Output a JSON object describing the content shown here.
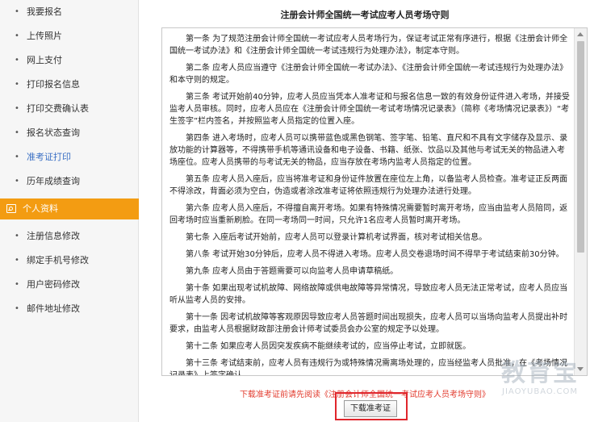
{
  "sidebar": {
    "items_top": [
      {
        "label": "我要报名",
        "active": false
      },
      {
        "label": "上传照片",
        "active": false
      },
      {
        "label": "网上支付",
        "active": false
      },
      {
        "label": "打印报名信息",
        "active": false
      },
      {
        "label": "打印交费确认表",
        "active": false
      },
      {
        "label": "报名状态查询",
        "active": false
      },
      {
        "label": "准考证打印",
        "active": true
      },
      {
        "label": "历年成绩查询",
        "active": false
      }
    ],
    "section_label": "个人资料",
    "items_bottom": [
      {
        "label": "注册信息修改"
      },
      {
        "label": "绑定手机号修改"
      },
      {
        "label": "用户密码修改"
      },
      {
        "label": "邮件地址修改"
      }
    ],
    "bullet": "•"
  },
  "main": {
    "title": "注册会计师全国统一考试应考人员考场守则",
    "rules": [
      "第一条 为了规范注册会计师全国统一考试应考人员考场行为，保证考试正常有序进行，根据《注册会计师全国统一考试办法》和《注册会计师全国统一考试违规行为处理办法》，制定本守则。",
      "第二条 应考人员应当遵守《注册会计师全国统一考试办法》、《注册会计师全国统一考试违规行为处理办法》和本守则的规定。",
      "第三条 考试开始前40分钟，应考人员应当凭本人准考证和与报名信息一致的有效身份证件进入考场，并接受监考人员审核。同时，应考人员应在《注册会计师全国统一考试考场情况记录表》（简称《考场情况记录表》）“考生签字”栏内签名，并按照监考人员指定的位置入座。",
      "第四条 进入考场时，应考人员可以携带蓝色或黑色钢笔、签字笔、铅笔、直尺和不具有文字储存及显示、录放功能的计算器等，不得携带手机等通讯设备和电子设备、书籍、纸张、饮品以及其他与考试无关的物品进入考场座位。应考人员携带的与考试无关的物品，应当存放在考场内监考人员指定的位置。",
      "第五条 应考人员入座后，应当将准考证和身份证件放置在座位左上角，以备监考人员检查。准考证正反两面不得涂改，背面必须为空白，伪造或者涂改准考证将依照违规行为处理办法进行处理。",
      "第六条 应考人员入座后，不得擅自离开考场。如果有特殊情况需要暂时离开考场，应当由监考人员陪同，返回考场时应当重新刷脸。在同一考场同一时间，只允许1名应考人员暂时离开考场。",
      "第七条 入座后考试开始前，应考人员可以登录计算机考试界面，核对考试相关信息。",
      "第八条 考试开始30分钟后，应考人员不得进入考场。应考人员交卷退场时间不得早于考试结束前30分钟。",
      "第九条 应考人员由于答题需要可以向监考人员申请草稿纸。",
      "第十条 如果出现考试机故障、网络故障或供电故障等异常情况，导致应考人员无法正常考试，应考人员应当听从监考人员的安排。",
      "第十一条 因考试机故障等客观原因导致应考人员答题时间出现损失，应考人员可以当场向监考人员提出补时要求，由监考人员根据财政部注册会计师考试委员会办公室的规定予以处理。",
      "第十二条 如果应考人员因突发疾病不能继续考试的，应当停止考试，立即就医。",
      "第十三条 考试结束前，应考人员有违规行为或特殊情况需离场处理的，应当经监考人员批准，在《考场情况记录表》上签字确认。"
    ],
    "notice": "下载准考证前请先阅读《注册会计师全国统一考试应考人员考场守则》",
    "download_label": "下载准考证"
  },
  "watermark": {
    "cn": "教育宝",
    "en": "JIAOYUBAO.COM"
  }
}
